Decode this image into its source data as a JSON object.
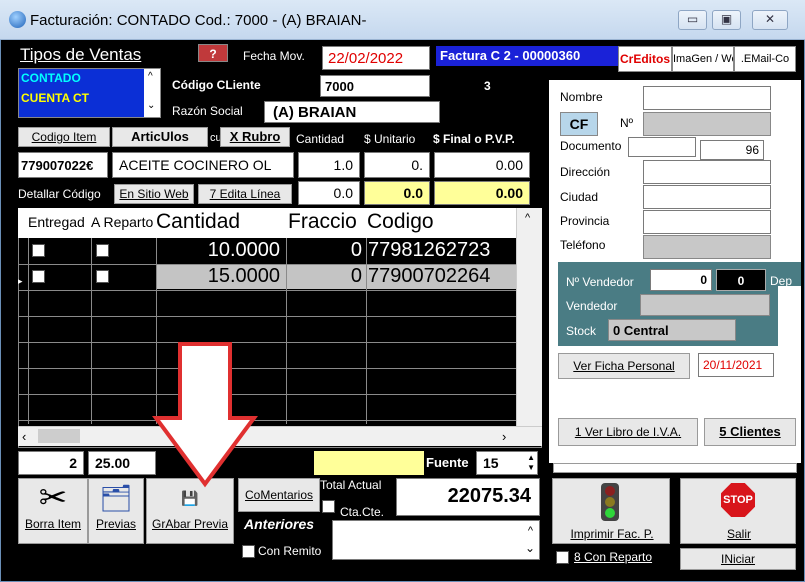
{
  "window": {
    "title": "Facturación: CONTADO Cod.: 7000 - (A) BRAIAN-",
    "controls": {
      "minimize": "▭",
      "maximize": "▣",
      "close": "✕"
    }
  },
  "header": {
    "tipos_label": "Tipos de Ventas",
    "help_button": "?",
    "fecha_label": "Fecha Mov.",
    "fecha_value": "22/02/2022",
    "factura_label": "Factura  C   2 - 00000360",
    "tabs": [
      "CrEditos",
      "ImaGen / Web",
      ".EMail-Co"
    ],
    "sale_types": [
      "CONTADO",
      "CUENTA CT"
    ],
    "codigo_cliente_label": "Código CLiente",
    "codigo_cliente_value": "7000",
    "counter_value": "3",
    "razon_social_label": "Razón Social",
    "razon_social_value": "(A) BRAIAN"
  },
  "item_entry": {
    "codigo_item_button": "Codigo Item",
    "articulos_button": "ArticUlos",
    "cu_label": "cu",
    "x_rubro_button": "X Rubro",
    "cantidad_label": "Cantidad",
    "unitario_label": "$ Unitario",
    "final_label": "$ Final o P.V.P.",
    "codigo_value": "779007022€",
    "descripcion_value": "ACEITE COCINERO OL",
    "cantidad_value": "1.0",
    "unitario_value": "0.",
    "final_value": "0.00",
    "detallar_label": "Detallar Código",
    "en_sitio_web_button": "En Sitio Web",
    "edita_linea_button": "7 Edita Línea",
    "cantidad2_value": "0.0",
    "unitario2_value": "0.0",
    "final2_value": "0.00"
  },
  "grid": {
    "columns": [
      "Entregad",
      "A Reparto",
      "Cantidad",
      "Fraccio",
      "Codigo"
    ],
    "rows": [
      {
        "cantidad": "10.0000",
        "fraccion": "0",
        "codigo": "77981262723"
      },
      {
        "cantidad": "15.0000",
        "fraccion": "0",
        "codigo": "77900702264"
      }
    ]
  },
  "totals_bar": {
    "count": "2",
    "quantity": "25.00",
    "fuente_label": "Fuente",
    "fuente_value": "15"
  },
  "bottom": {
    "borra_item": "Borra Item",
    "previas": "Previas",
    "grabar_previa": "GrAbar Previa",
    "comentarios": "CoMentarios",
    "anteriores": "Anteriores",
    "con_remito": "Con Remito",
    "total_actual_label": "Total Actual",
    "total_value": "22075.34",
    "cta_cte": "Cta.Cte.",
    "imprimir": "Imprimir Fac. P.",
    "con_reparto": "8 Con Reparto",
    "salir": "Salir",
    "iniciar": "INiciar",
    "stop_text": "STOP"
  },
  "client_panel": {
    "nombre_label": "Nombre",
    "cf_value": "CF",
    "no_label": "Nº",
    "documento_label": "Documento",
    "documento_value": "96",
    "direccion_label": "Dirección",
    "ciudad_label": "Ciudad",
    "provincia_label": "Provincia",
    "telefono_label": "Teléfono",
    "no_vendedor_label": "Nº Vendedor",
    "no_vendedor_value": "0",
    "vendedor_code": "0",
    "dep_label": "Dep",
    "vendedor_label": "Vendedor",
    "stock_label": "Stock",
    "stock_value": "0  Central",
    "ver_ficha": "Ver Ficha Personal",
    "ficha_date": "20/11/2021",
    "libro_iva": "1 Ver Libro de I.V.A.",
    "clientes": "5 Clientes"
  },
  "colors": {
    "accent_blue": "#0b2fd6",
    "factura_bg": "#1a22d8",
    "highlight_cyan": "#00ffff",
    "date_red": "#e00000",
    "yellow": "#ffff99",
    "teal": "#4a7c84"
  }
}
